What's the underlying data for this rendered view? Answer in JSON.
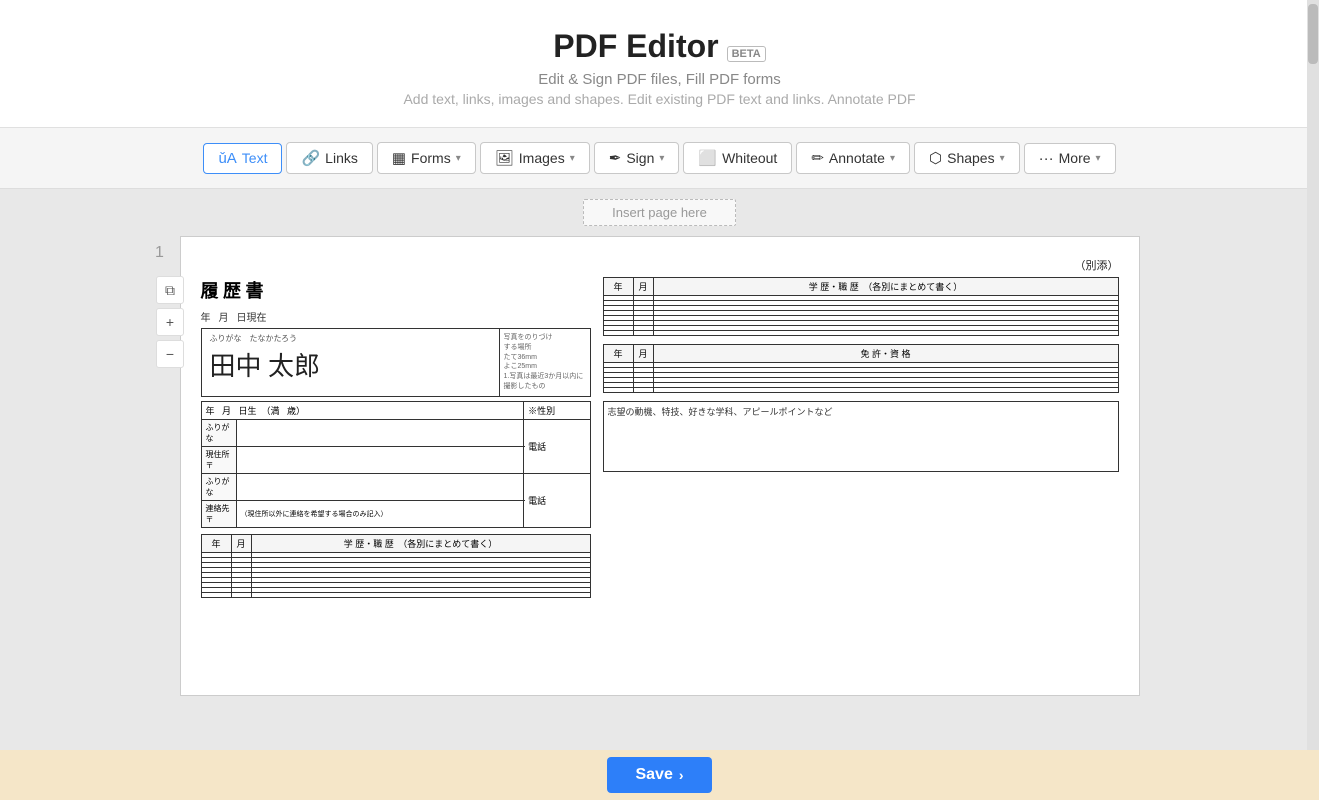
{
  "header": {
    "title": "PDF Editor",
    "beta": "BETA",
    "subtitle1": "Edit & Sign PDF files, Fill PDF forms",
    "subtitle2": "Add text, links, images and shapes. Edit existing PDF text and links. Annotate PDF"
  },
  "toolbar": {
    "text_label": "Text",
    "links_label": "Links",
    "forms_label": "Forms",
    "images_label": "Images",
    "sign_label": "Sign",
    "whiteout_label": "Whiteout",
    "annotate_label": "Annotate",
    "shapes_label": "Shapes",
    "more_label": "More"
  },
  "page": {
    "insert_label": "Insert page here",
    "page_number": "1",
    "pdf_header_right": "（別添）"
  },
  "resume": {
    "title": "履 歴 書",
    "furigana": "ふりがな　たなかたろう",
    "name": "田中 太郎",
    "photo_text": "写真をのりづけ\nする場所\nたて36mm\nよこ25mm\n1.写真は最近3か月以内に\n撮影したもの",
    "dob_label": "年",
    "address_furigana": "ふりがな",
    "address_label": "現住所 〒",
    "tel_label": "電話",
    "contact_furigana": "ふりがな",
    "contact_label": "連絡先 〒",
    "contact_note": "（現住所以外に連絡を希望する場合のみ記入）",
    "career_header": "学 歴・職 歴　（各別にまとめて書く）",
    "yr_label": "年",
    "mo_label": "月",
    "qual_header": "免 許・資 格",
    "remarks_label": "志望の動機、特技、好きな学科、アピールポイントなど"
  },
  "save": {
    "label": "Save"
  }
}
